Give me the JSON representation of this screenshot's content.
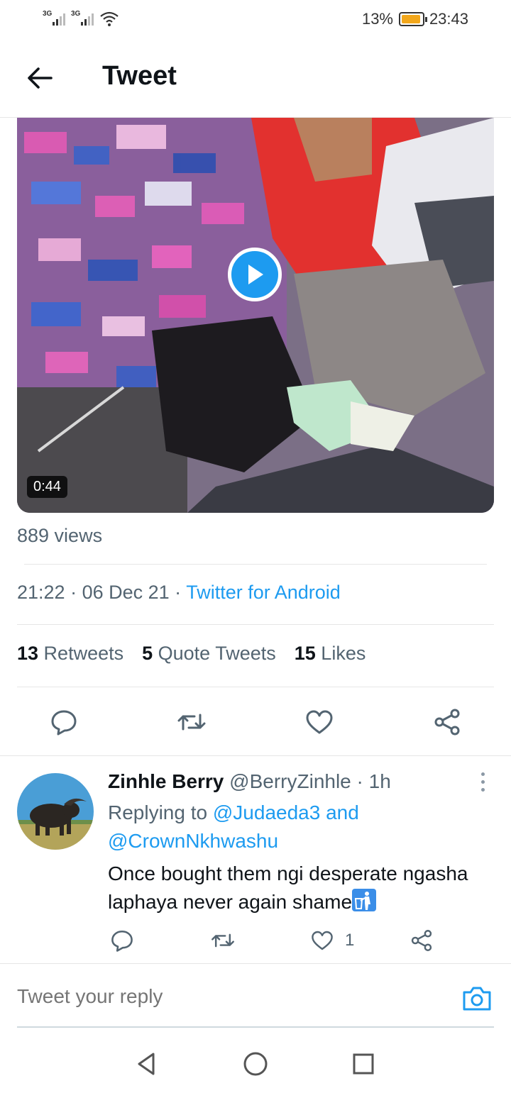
{
  "status_bar": {
    "network_1": "3G",
    "network_2": "3G",
    "battery_percent": "13%",
    "battery_level": 0.13,
    "time": "23:43",
    "icons": [
      "signal-icon",
      "signal-icon",
      "wifi-icon",
      "battery-charging-icon"
    ]
  },
  "header": {
    "title": "Tweet",
    "back_icon": "arrow-left-icon"
  },
  "video": {
    "duration": "0:44",
    "play_icon": "play-icon"
  },
  "tweet": {
    "views": "889 views",
    "time": "21:22",
    "date": "06 Dec 21",
    "source": "Twitter for Android",
    "separator": " · ",
    "stats": [
      {
        "count": "13",
        "label": " Retweets"
      },
      {
        "count": "5",
        "label": " Quote Tweets"
      },
      {
        "count": "15",
        "label": " Likes"
      }
    ],
    "actions": [
      "reply-icon",
      "retweet-icon",
      "like-icon",
      "share-icon"
    ]
  },
  "reply": {
    "name": "Zinhle Berry",
    "handle": " @BerryZinhle · 1h",
    "replying_prefix": "Replying to ",
    "replying_user_1": "@Judaeda3",
    "replying_and": " and",
    "replying_user_2": "@CrownNkhwashu",
    "text": "Once bought them ngi desperate ngasha laphaya never again shame",
    "emoji": "put-litter-in-its-place-emoji",
    "like_count": "1",
    "actions": [
      "reply-icon",
      "retweet-icon",
      "like-icon",
      "share-icon"
    ]
  },
  "compose": {
    "placeholder": "Tweet your reply",
    "camera_icon": "camera-icon"
  },
  "nav": [
    "back-triangle-icon",
    "home-circle-icon",
    "recents-square-icon"
  ],
  "colors": {
    "accent": "#1d9bf0",
    "text_primary": "#0f1419",
    "text_secondary": "#536471",
    "divider": "#e6e6e6"
  }
}
